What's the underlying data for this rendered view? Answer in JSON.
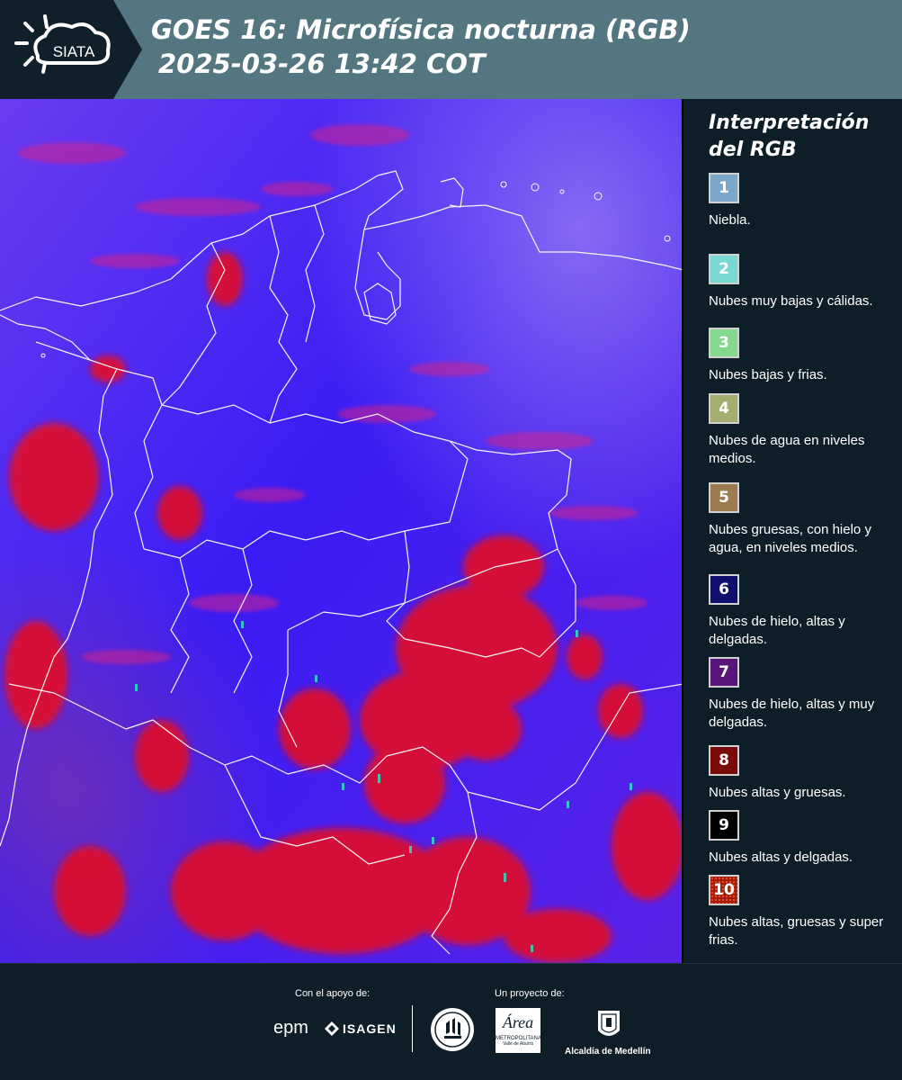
{
  "header": {
    "logo_text": "SIATA",
    "title_line1": "GOES 16: Microfísica nocturna (RGB)",
    "title_line2": "2025-03-26 13:42 COT"
  },
  "legend": {
    "title": "Interpretación del RGB",
    "items": [
      {
        "number": "1",
        "label": "Niebla.",
        "color": "#7aa6c9"
      },
      {
        "number": "2",
        "label": "Nubes muy bajas y cálidas.",
        "color": "#7ad8d3"
      },
      {
        "number": "3",
        "label": "Nubes bajas y frias.",
        "color": "#85d98f"
      },
      {
        "number": "4",
        "label": "Nubes de agua en niveles medios.",
        "color": "#a4ad6e"
      },
      {
        "number": "5",
        "label": "Nubes gruesas, con hielo y agua, en niveles medios.",
        "color": "#9c7c4f"
      },
      {
        "number": "6",
        "label": "Nubes de hielo, altas y delgadas.",
        "color": "#0f0f6e"
      },
      {
        "number": "7",
        "label": "Nubes de hielo, altas y muy delgadas.",
        "color": "#5a157d"
      },
      {
        "number": "8",
        "label": "Nubes altas y gruesas.",
        "color": "#7a0b0b"
      },
      {
        "number": "9",
        "label": "Nubes altas y delgadas.",
        "color": "#000000"
      },
      {
        "number": "10",
        "label": "Nubes altas, gruesas y super frias.",
        "color": "#b01a0a"
      }
    ]
  },
  "footer": {
    "support_caption": "Con el apoyo de:",
    "project_caption": "Un proyecto de:",
    "epm_logo": "epm",
    "isagen_logo": "ISAGEN",
    "metropolitana_name": "METROPOLITANA",
    "metropolitana_sub": "Valle de Aburrá",
    "area_logo": "Área",
    "alcaldia_name": "Alcaldía de Medellín"
  },
  "colors": {
    "header_bg": "#537680",
    "panel_bg": "#0e1e29",
    "map_base": "#4a1cf0",
    "cloud_red": "#e0102a",
    "border_line": "#ffffff"
  }
}
